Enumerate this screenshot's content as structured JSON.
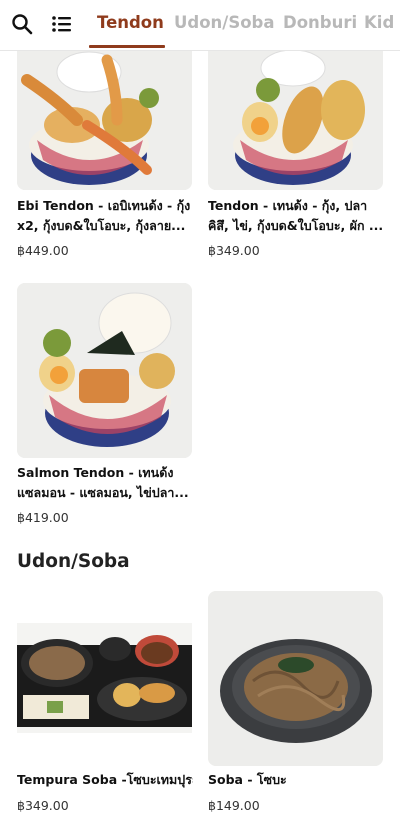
{
  "header": {
    "search_icon": "search-icon",
    "menu_icon": "list-menu-icon",
    "tabs": [
      {
        "label": "Tendon",
        "active": true
      },
      {
        "label": "Udon/Soba",
        "active": false
      },
      {
        "label": "Donburi",
        "active": false
      },
      {
        "label": "Kid",
        "active": false
      }
    ],
    "accent_color": "#8f3b1c"
  },
  "sections": {
    "tendon_items": [
      {
        "name": "Ebi Tendon - เอบิเทนด้ง - กุ้ง x2, กุ้งบด&ใบโอบะ, กุ้งลาย...",
        "price": "฿449.00"
      },
      {
        "name": "Tendon - เทนด้ง - กุ้ง, ปลาคิสึ, ไข่, กุ้งบด&ใบโอบะ, ผัก ...",
        "price": "฿349.00"
      },
      {
        "name": "Salmon Tendon - เทนด้ง แซลมอน - แซลมอน, ไข่ปลา...",
        "price": "฿419.00"
      }
    ],
    "udon_soba": {
      "title": "Udon/Soba",
      "items": [
        {
          "name": "Tempura Soba -โซบะเทมปุระ",
          "price": "฿349.00"
        },
        {
          "name": "Soba - โซบะ",
          "price": "฿149.00"
        }
      ]
    }
  }
}
